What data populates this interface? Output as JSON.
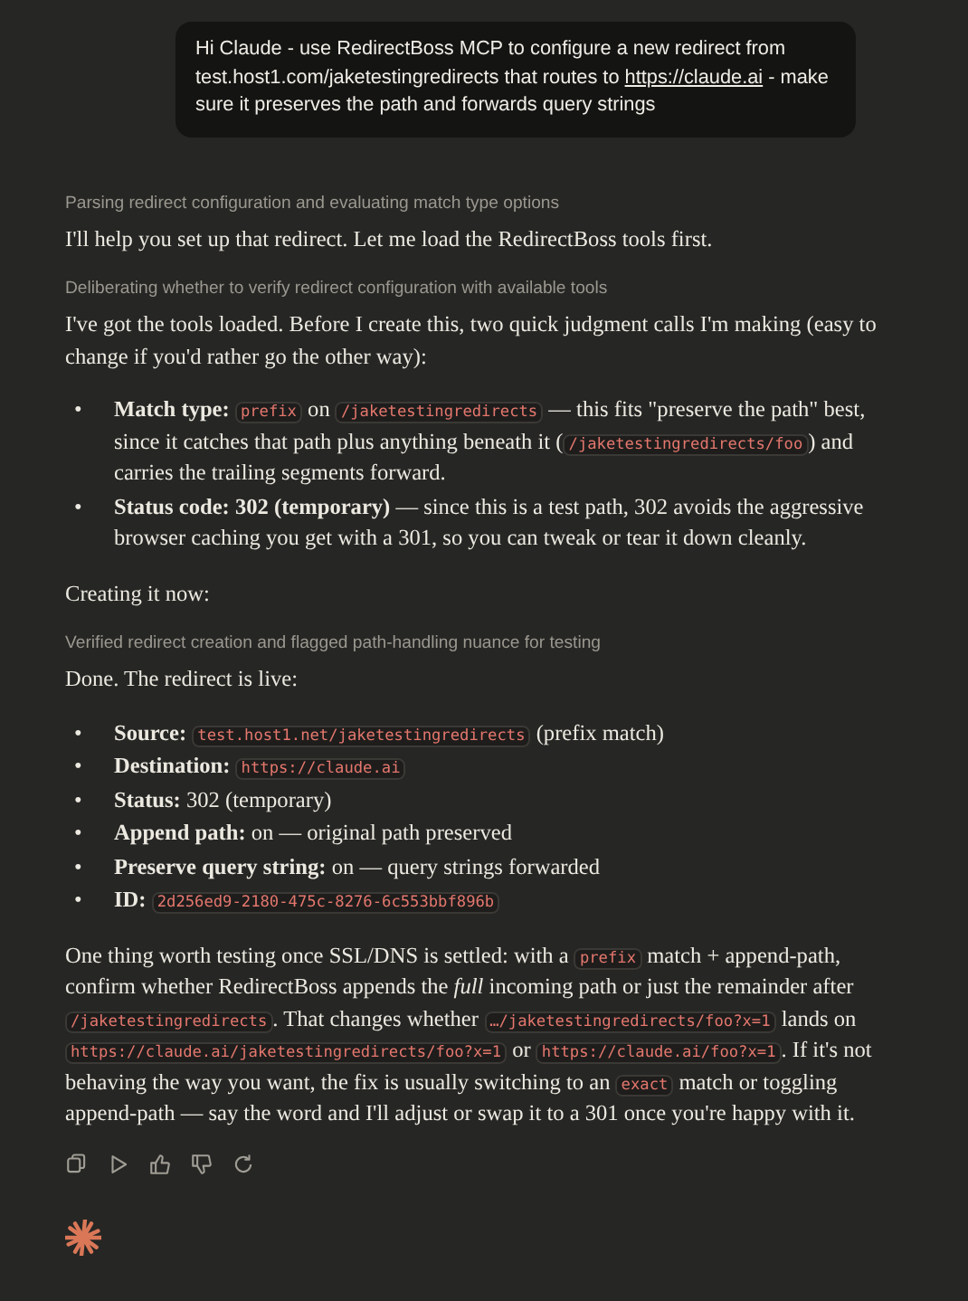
{
  "user_message": {
    "segments": [
      {
        "kind": "text",
        "text": "Hi Claude - use RedirectBoss MCP to configure a new redirect from test.host1.com/jaketestingredirects that routes to "
      },
      {
        "kind": "link",
        "text": "https://claude.ai"
      },
      {
        "kind": "text",
        "text": " - make sure it preserves the path and forwards query strings"
      }
    ]
  },
  "blocks": [
    {
      "kind": "thinking",
      "text": "Parsing redirect configuration and evaluating match type options"
    },
    {
      "kind": "paragraph",
      "segments": [
        {
          "kind": "text",
          "text": "I'll help you set up that redirect. Let me load the RedirectBoss tools first."
        }
      ]
    },
    {
      "kind": "thinking",
      "text": "Deliberating whether to verify redirect configuration with available tools"
    },
    {
      "kind": "paragraph",
      "segments": [
        {
          "kind": "text",
          "text": "I've got the tools loaded. Before I create this, two quick judgment calls I'm making (easy to change if you'd rather go the other way):"
        }
      ]
    },
    {
      "kind": "list",
      "items": [
        {
          "marker": "•",
          "segments": [
            {
              "kind": "text",
              "text": "**Match type:** "
            },
            {
              "kind": "code",
              "text": "prefix"
            },
            {
              "kind": "text",
              "text": " on "
            },
            {
              "kind": "code",
              "text": "/jaketestingredirects"
            },
            {
              "kind": "text",
              "text": " — this fits \"preserve the path\" best, since it catches that path plus anything beneath it ("
            },
            {
              "kind": "code",
              "text": "/jaketestingredirects/foo"
            },
            {
              "kind": "text",
              "text": ") and carries the trailing segments forward."
            }
          ]
        },
        {
          "marker": "•",
          "segments": [
            {
              "kind": "text",
              "text": "**Status code: 302 (temporary)** — since this is a test path, 302 avoids the aggressive browser caching you get with a 301, so you can tweak or tear it down cleanly."
            }
          ]
        }
      ]
    },
    {
      "kind": "paragraph",
      "segments": [
        {
          "kind": "text",
          "text": "Creating it now:"
        }
      ]
    },
    {
      "kind": "thinking",
      "text": "Verified redirect creation and flagged path-handling nuance for testing"
    },
    {
      "kind": "paragraph",
      "segments": [
        {
          "kind": "text",
          "text": "Done. The redirect is live:"
        }
      ]
    },
    {
      "kind": "list",
      "items": [
        {
          "marker": "•",
          "segments": [
            {
              "kind": "text",
              "text": "**Source:** "
            },
            {
              "kind": "code",
              "text": "test.host1.net/jaketestingredirects"
            },
            {
              "kind": "text",
              "text": " (prefix match)"
            }
          ]
        },
        {
          "marker": "•",
          "segments": [
            {
              "kind": "text",
              "text": "**Destination:** "
            },
            {
              "kind": "code",
              "text": "https://claude.ai"
            }
          ]
        },
        {
          "marker": "•",
          "segments": [
            {
              "kind": "text",
              "text": "**Status:** 302 (temporary)"
            }
          ]
        },
        {
          "marker": "•",
          "segments": [
            {
              "kind": "text",
              "text": "**Append path:** on — original path preserved"
            }
          ]
        },
        {
          "marker": "•",
          "segments": [
            {
              "kind": "text",
              "text": "**Preserve query string:** on — query strings forwarded"
            }
          ]
        },
        {
          "marker": "•",
          "segments": [
            {
              "kind": "text",
              "text": "**ID:** "
            },
            {
              "kind": "code",
              "text": "2d256ed9-2180-475c-8276-6c553bbf896b"
            }
          ]
        }
      ]
    },
    {
      "kind": "paragraph",
      "segments": [
        {
          "kind": "text",
          "text": "One thing worth testing once SSL/DNS is settled: with a "
        },
        {
          "kind": "code",
          "text": "prefix"
        },
        {
          "kind": "text",
          "text": " match + append-path, confirm whether RedirectBoss appends the *full* incoming path or just the remainder after "
        },
        {
          "kind": "code",
          "text": "/jaketestingredirects"
        },
        {
          "kind": "text",
          "text": ". That changes whether "
        },
        {
          "kind": "code",
          "text": "…/jaketestingredirects/foo?x=1"
        },
        {
          "kind": "text",
          "text": " lands on "
        },
        {
          "kind": "code",
          "text": "https://claude.ai/jaketestingredirects/foo?x=1"
        },
        {
          "kind": "text",
          "text": " or "
        },
        {
          "kind": "code",
          "text": "https://claude.ai/foo?x=1"
        },
        {
          "kind": "text",
          "text": ". If it's not behaving the way you want, the fix is usually switching to an "
        },
        {
          "kind": "code",
          "text": "exact"
        },
        {
          "kind": "text",
          "text": " match or toggling append-path — say the word and I'll adjust or swap it to a 301 once you're happy with it."
        }
      ]
    }
  ],
  "actions": [
    {
      "kind": "copy"
    },
    {
      "kind": "play"
    },
    {
      "kind": "thumbs-up"
    },
    {
      "kind": "thumbs-down"
    },
    {
      "kind": "retry"
    }
  ]
}
